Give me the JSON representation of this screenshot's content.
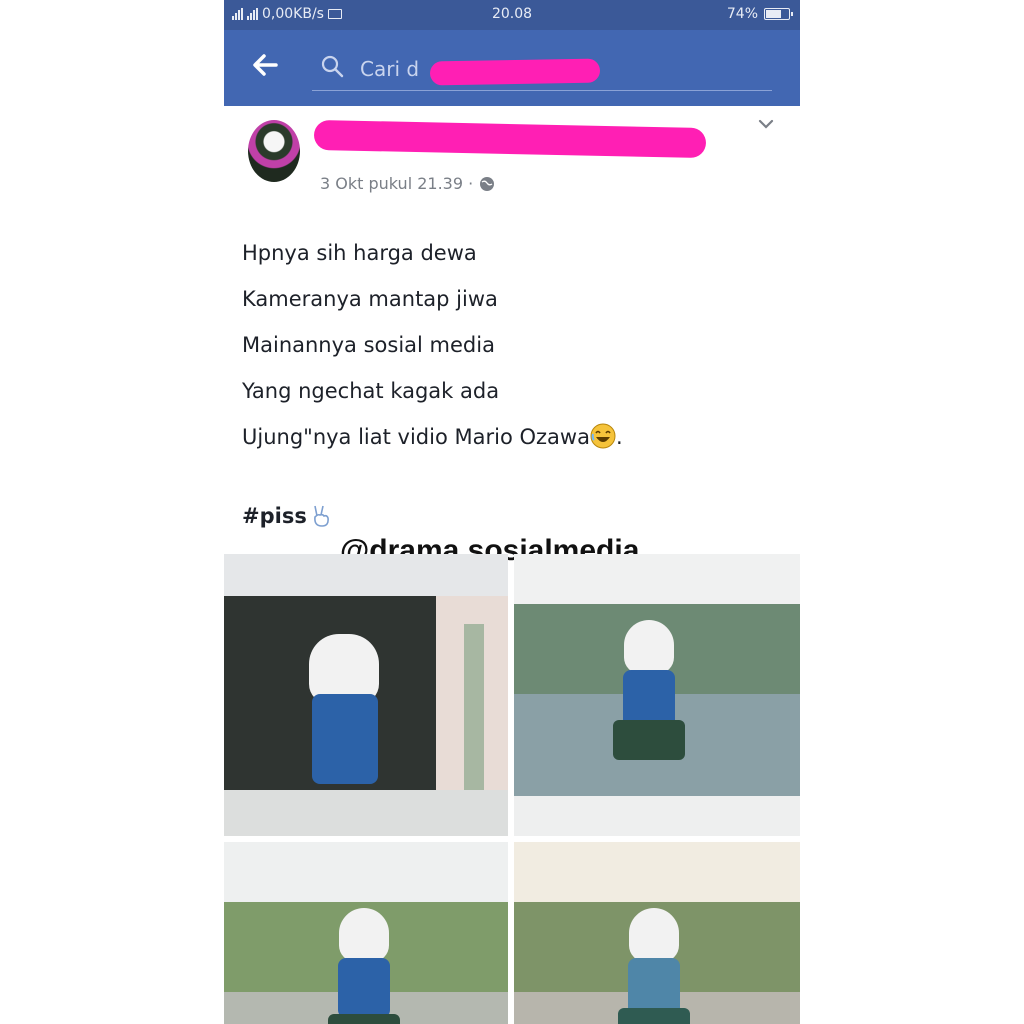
{
  "status_bar": {
    "network": "0,00KB/s",
    "time": "20.08",
    "battery": "74%",
    "battery_level": 0.74
  },
  "app_bar": {
    "back_icon": "arrow-left-icon",
    "search_placeholder": "Cari d",
    "search_icon": "search-icon"
  },
  "post": {
    "author_name": "",
    "timestamp": "3 Okt pukul 21.39 ·",
    "privacy_icon": "globe-icon",
    "menu_icon": "chevron-down-icon",
    "lines": [
      "Hpnya sih harga dewa",
      "Kameranya mantap jiwa",
      "Mainannya sosial media",
      "Yang ngechat kagak ada",
      "Ujung\"nya liat vidio Mario Ozawa"
    ],
    "line5_suffix": ".",
    "emoji_icon": "laughing-emoji-icon",
    "hashtag": "#piss",
    "hashtag_icon": "peace-hand-icon",
    "photo_count": 4
  },
  "watermark": "@drama.sosialmedia",
  "colors": {
    "status_bar": "#3b5998",
    "app_bar": "#4267b2",
    "redaction": "#ff1fb4"
  }
}
